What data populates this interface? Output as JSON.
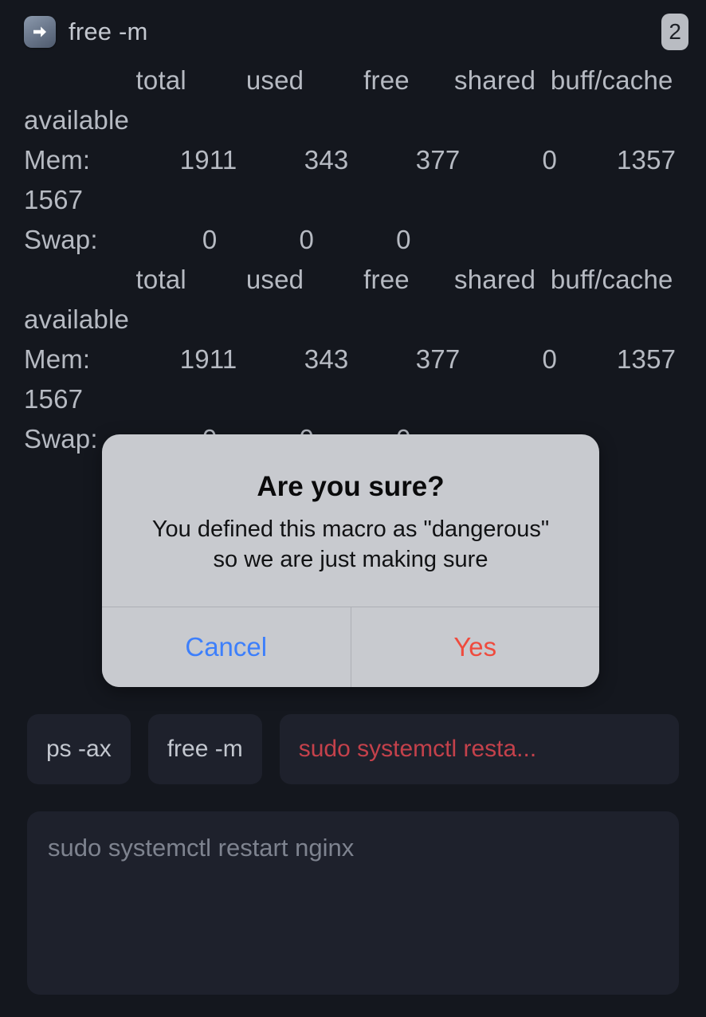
{
  "app": {
    "background_color": "#14171e",
    "surface_color": "#1e212c"
  },
  "command_header": {
    "icon": "arrow-right-run-icon",
    "title": "free -m",
    "badge_count": "2",
    "badge_color": "#b9bcc2",
    "title_color": "#c3c7cf"
  },
  "terminal": {
    "text_color": "#b6bac2",
    "blocks": [
      "               total        used        free      shared  buff/cache   available\nMem:            1911         343         377           0        1357        1567\nSwap:              0           0           0",
      "               total        used        free      shared  buff/cache   available\nMem:            1911         343         377           0        1357        1567\nSwap:              0           0           0"
    ],
    "parsed": {
      "columns": [
        "total",
        "used",
        "free",
        "shared",
        "buff/cache",
        "available"
      ],
      "rows": [
        {
          "label": "Mem:",
          "values": [
            "1911",
            "343",
            "377",
            "0",
            "1357",
            "1567"
          ]
        },
        {
          "label": "Swap:",
          "values": [
            "0",
            "0",
            "0"
          ]
        }
      ]
    }
  },
  "dialog": {
    "title": "Are you sure?",
    "message": "You defined this macro as \"dangerous\"\nso we are just making sure",
    "cancel_label": "Cancel",
    "confirm_label": "Yes",
    "cancel_color": "#3d7ffb",
    "confirm_color": "#ef4b3e",
    "background_color": "#c8cacf"
  },
  "macros": [
    {
      "label": "ps -ax",
      "dangerous": false
    },
    {
      "label": "free -m",
      "dangerous": false
    },
    {
      "label": "sudo systemctl resta...",
      "dangerous": true,
      "danger_color": "#c4414b"
    }
  ],
  "command_input": {
    "value": "sudo systemctl restart nginx",
    "placeholder": "sudo systemctl restart nginx",
    "text_color": "#7e838f"
  }
}
